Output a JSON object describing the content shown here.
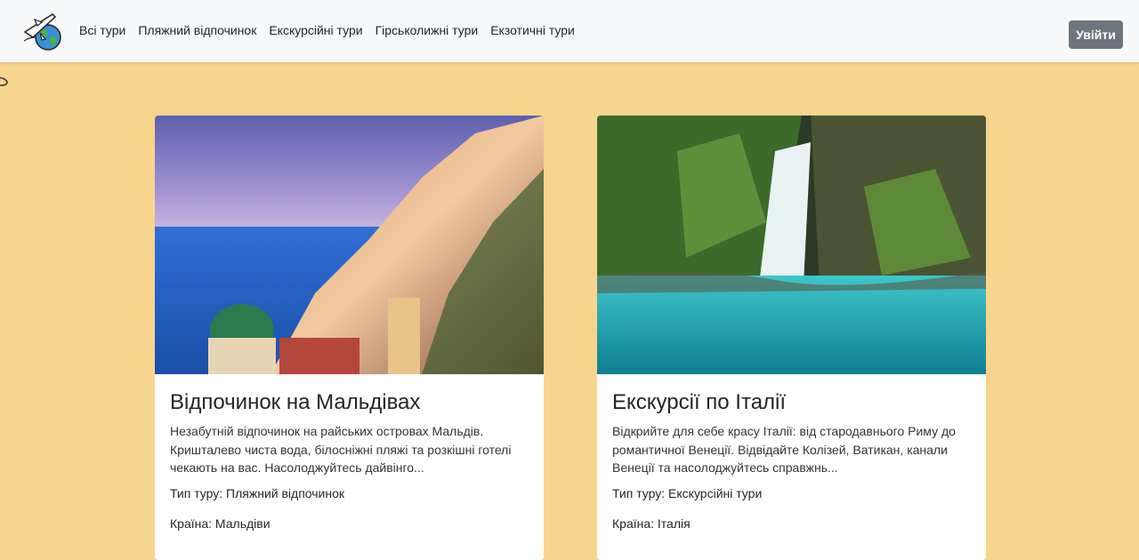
{
  "nav": {
    "logo": "travel-logo",
    "links": [
      "Всі тури",
      "Пляжний відпочинок",
      "Екскурсійні тури",
      "Гірськолижні тури",
      "Екзотичні тури"
    ],
    "login_label": "Увійти"
  },
  "cards": [
    {
      "image": "amalfi-coast-photo",
      "title": "Відпочинок на Мальдівах",
      "description": "Незабутній відпочинок на райських островах Мальдів. Кришталево чиста вода, білосніжні пляжі та розкішні готелі чекають на вас. Насолоджуйтесь дайвінго...",
      "tour_type": "Тип туру: Пляжний відпочинок",
      "country": "Країна: Мальдіви"
    },
    {
      "image": "waterfall-photo",
      "title": "Екскурсії по Італії",
      "description": "Відкрийте для себе красу Італії: від стародавнього Риму до романтичної Венеції. Відвідайте Колізей, Ватикан, канали Венеції та насолоджуйтесь справжнь...",
      "tour_type": "Тип туру: Екскурсійні тури",
      "country": "Країна: Італія"
    }
  ],
  "colors": {
    "page_background": "#f7d58e",
    "navbar_background": "#f8f9fa",
    "button_background": "#6c757d"
  }
}
